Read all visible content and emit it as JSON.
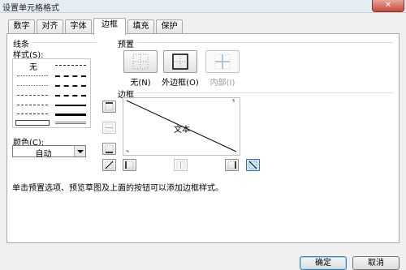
{
  "window": {
    "title": "设置单元格格式",
    "close_glyph": "✕"
  },
  "tabs": [
    {
      "label": "数字",
      "active": false
    },
    {
      "label": "对齐",
      "active": false
    },
    {
      "label": "字体",
      "active": false
    },
    {
      "label": "边框",
      "active": true
    },
    {
      "label": "填充",
      "active": false
    },
    {
      "label": "保护",
      "active": false
    }
  ],
  "line": {
    "group_label": "线条",
    "style_label": "样式(S):",
    "none_label": "无",
    "color_label": "颜色(C):",
    "color_value": "自动"
  },
  "presets": {
    "group_label": "预置",
    "items": [
      {
        "label": "无(N)",
        "icon": "border-none-icon",
        "enabled": true
      },
      {
        "label": "外边框(O)",
        "icon": "border-outline-icon",
        "enabled": true
      },
      {
        "label": "内部(I)",
        "icon": "border-inside-icon",
        "enabled": false
      }
    ]
  },
  "border": {
    "group_label": "边框",
    "preview_text": "文本",
    "buttons": [
      "border-top-icon",
      "border-inside-horizontal-icon",
      "border-bottom-icon",
      "border-diagonal-up-icon",
      "border-left-icon",
      "border-inside-vertical-icon",
      "border-right-icon",
      "border-diagonal-down-icon"
    ]
  },
  "hint": "单击预置选项、预览草图及上面的按钮可以添加边框样式。",
  "footer": {
    "ok_label": "确定",
    "cancel_label": "取消"
  },
  "colors": {
    "accent": "#3c7fb1",
    "panel_border": "#a9a9a9",
    "separator": "#d5dfe5"
  }
}
